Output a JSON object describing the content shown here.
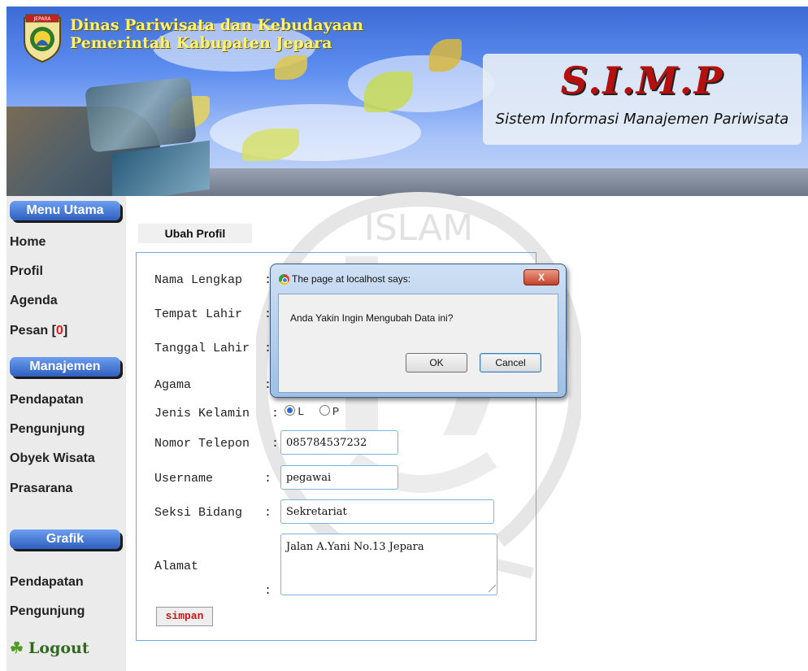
{
  "header": {
    "agency_line1": "Dinas Pariwisata dan Kebudayaan",
    "agency_line2": "Pemerintah Kabupaten Jepara",
    "logo_label": "JEPARA",
    "app_title": "S.I.M.P",
    "app_subtitle": "Sistem Informasi Manajemen Pariwisata"
  },
  "sidebar": {
    "menu_utama": "Menu Utama",
    "items_main": [
      {
        "label": "Home"
      },
      {
        "label": "Profil"
      },
      {
        "label": "Agenda"
      },
      {
        "label": "Pesan [",
        "count": "0",
        "suffix": "]"
      }
    ],
    "manajemen": "Manajemen",
    "items_manajemen": [
      {
        "label": "Pendapatan"
      },
      {
        "label": "Pengunjung"
      },
      {
        "label": "Obyek Wisata"
      },
      {
        "label": "Prasarana"
      }
    ],
    "grafik": "Grafik",
    "items_grafik": [
      {
        "label": "Pendapatan"
      },
      {
        "label": "Pengunjung"
      }
    ],
    "logout": "Logout",
    "logout_icon": "leaf-logout-icon"
  },
  "form": {
    "tab_label": "Ubah Profil",
    "labels": {
      "nama": "Nama Lengkap",
      "tempat": "Tempat Lahir",
      "tanggal": "Tanggal Lahir",
      "agama": "Agama",
      "jk": "Jenis Kelamin",
      "telepon": "Nomor Telepon",
      "username": "Username",
      "seksi": "Seksi Bidang",
      "alamat": "Alamat"
    },
    "colon": ":",
    "gender_options": [
      "L",
      "P"
    ],
    "gender_selected": "L",
    "telepon_value": "085784537232",
    "username_value": "pegawai",
    "seksi_value": "Sekretariat",
    "alamat_value": "Jalan A.Yani No.13 Jepara",
    "submit_label": "simpan"
  },
  "watermark": {
    "top_text": "ISLAM"
  },
  "dialog": {
    "title": "The page at localhost says:",
    "message": "Anda Yakin Ingin Mengubah Data ini?",
    "ok_label": "OK",
    "cancel_label": "Cancel",
    "close_label": "X"
  }
}
